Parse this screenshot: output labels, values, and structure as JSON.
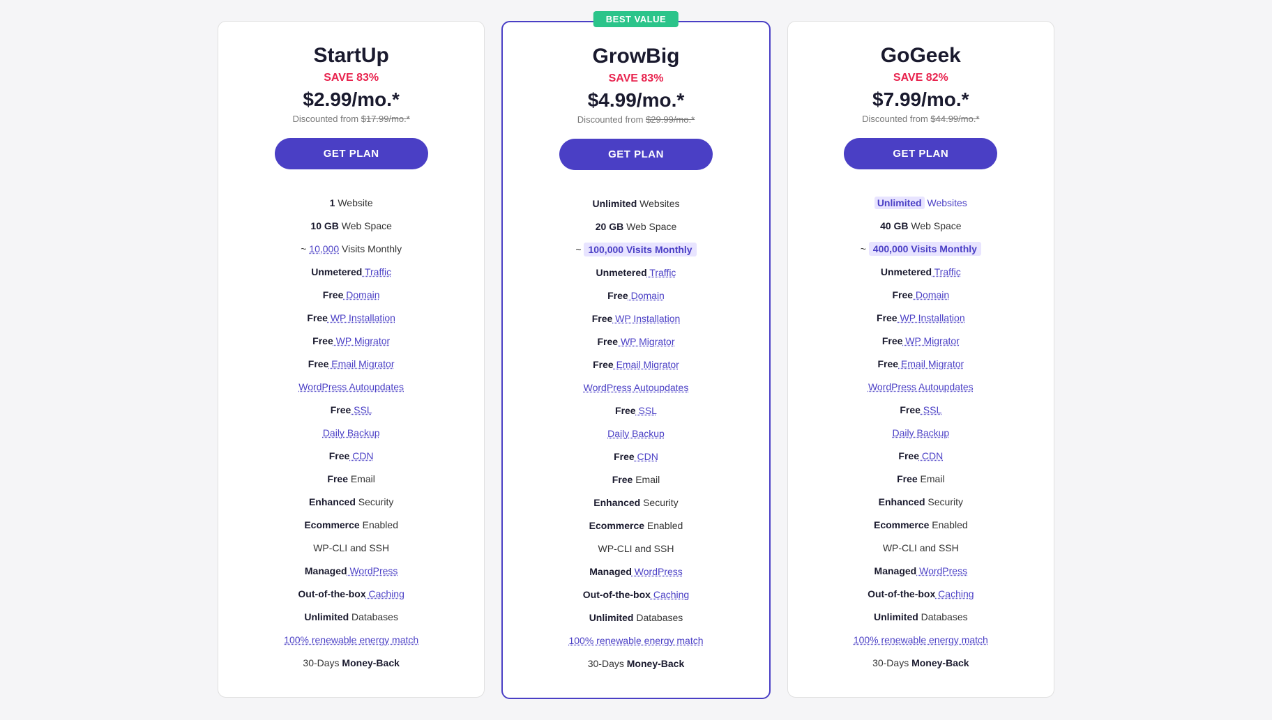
{
  "plans": [
    {
      "id": "startup",
      "name": "StartUp",
      "save": "SAVE 83%",
      "price": "$2.99/mo.*",
      "original": "$17.99/mo.*",
      "originalText": "Discounted from",
      "btn": "GET PLAN",
      "featured": false,
      "features": [
        {
          "text": "1 Website",
          "parts": [
            {
              "t": "1",
              "style": "bold"
            },
            {
              "t": " Website",
              "style": "normal"
            }
          ]
        },
        {
          "text": "10 GB Web Space",
          "parts": [
            {
              "t": "10 GB",
              "style": "bold"
            },
            {
              "t": " Web Space",
              "style": "normal"
            }
          ]
        },
        {
          "text": "~ 10,000 Visits Monthly",
          "parts": [
            {
              "t": "~ "
            },
            {
              "t": "10,000",
              "style": "link"
            },
            {
              "t": " Visits Monthly",
              "style": "normal"
            }
          ]
        },
        {
          "text": "Unmetered Traffic",
          "parts": [
            {
              "t": "Unmetered",
              "style": "bold"
            },
            {
              "t": " Traffic",
              "style": "link"
            }
          ]
        },
        {
          "text": "Free Domain",
          "parts": [
            {
              "t": "Free",
              "style": "bold"
            },
            {
              "t": " Domain",
              "style": "link"
            }
          ]
        },
        {
          "text": "Free WP Installation",
          "parts": [
            {
              "t": "Free",
              "style": "bold"
            },
            {
              "t": " WP Installation",
              "style": "link"
            }
          ]
        },
        {
          "text": "Free WP Migrator",
          "parts": [
            {
              "t": "Free",
              "style": "bold"
            },
            {
              "t": " WP Migrator",
              "style": "link"
            }
          ]
        },
        {
          "text": "Free Email Migrator",
          "parts": [
            {
              "t": "Free",
              "style": "bold"
            },
            {
              "t": " Email Migrator",
              "style": "link"
            }
          ]
        },
        {
          "text": "WordPress Autoupdates",
          "parts": [
            {
              "t": "WordPress Autoupdates",
              "style": "link"
            }
          ]
        },
        {
          "text": "Free SSL",
          "parts": [
            {
              "t": "Free",
              "style": "bold"
            },
            {
              "t": " SSL",
              "style": "link"
            }
          ]
        },
        {
          "text": "Daily Backup",
          "parts": [
            {
              "t": "Daily Backup",
              "style": "link"
            }
          ]
        },
        {
          "text": "Free CDN",
          "parts": [
            {
              "t": "Free",
              "style": "bold"
            },
            {
              "t": " CDN",
              "style": "link"
            }
          ]
        },
        {
          "text": "Free Email",
          "parts": [
            {
              "t": "Free",
              "style": "bold"
            },
            {
              "t": " Email",
              "style": "normal"
            }
          ]
        },
        {
          "text": "Enhanced Security",
          "parts": [
            {
              "t": "Enhanced",
              "style": "bold"
            },
            {
              "t": " Security",
              "style": "normal"
            }
          ]
        },
        {
          "text": "Ecommerce Enabled",
          "parts": [
            {
              "t": "Ecommerce",
              "style": "bold"
            },
            {
              "t": " Enabled",
              "style": "normal"
            }
          ]
        },
        {
          "text": "WP-CLI and SSH",
          "parts": [
            {
              "t": "WP-CLI and SSH",
              "style": "normal"
            }
          ]
        },
        {
          "text": "Managed WordPress",
          "parts": [
            {
              "t": "Managed",
              "style": "bold"
            },
            {
              "t": " WordPress",
              "style": "link"
            }
          ]
        },
        {
          "text": "Out-of-the-box Caching",
          "parts": [
            {
              "t": "Out-of-the-box",
              "style": "bold"
            },
            {
              "t": " Caching",
              "style": "link"
            }
          ]
        },
        {
          "text": "Unlimited Databases",
          "parts": [
            {
              "t": "Unlimited",
              "style": "bold"
            },
            {
              "t": " Databases",
              "style": "normal"
            }
          ]
        },
        {
          "text": "100% renewable energy match",
          "parts": [
            {
              "t": "100% renewable energy match",
              "style": "link"
            }
          ]
        },
        {
          "text": "30-Days Money-Back",
          "parts": [
            {
              "t": "30-Days",
              "style": "normal"
            },
            {
              "t": " Money-Back",
              "style": "bold"
            }
          ]
        }
      ]
    },
    {
      "id": "growbig",
      "name": "GrowBig",
      "save": "SAVE 83%",
      "price": "$4.99/mo.*",
      "original": "$29.99/mo.*",
      "originalText": "Discounted from",
      "btn": "GET PLAN",
      "featured": true,
      "bestValue": "BEST VALUE",
      "features": [
        {
          "text": "Unlimited Websites",
          "parts": [
            {
              "t": "Unlimited",
              "style": "bold"
            },
            {
              "t": " Websites",
              "style": "normal"
            }
          ]
        },
        {
          "text": "20 GB Web Space",
          "parts": [
            {
              "t": "20 GB",
              "style": "bold"
            },
            {
              "t": " Web Space",
              "style": "normal"
            }
          ]
        },
        {
          "text": "~ 100,000 Visits Monthly",
          "parts": [
            {
              "t": "~ "
            },
            {
              "t": "100,000 Visits Monthly",
              "style": "visits-highlight"
            }
          ]
        },
        {
          "text": "Unmetered Traffic",
          "parts": [
            {
              "t": "Unmetered",
              "style": "bold"
            },
            {
              "t": " Traffic",
              "style": "link"
            }
          ]
        },
        {
          "text": "Free Domain",
          "parts": [
            {
              "t": "Free",
              "style": "bold"
            },
            {
              "t": " Domain",
              "style": "link"
            }
          ]
        },
        {
          "text": "Free WP Installation",
          "parts": [
            {
              "t": "Free",
              "style": "bold"
            },
            {
              "t": " WP Installation",
              "style": "link"
            }
          ]
        },
        {
          "text": "Free WP Migrator",
          "parts": [
            {
              "t": "Free",
              "style": "bold"
            },
            {
              "t": " WP Migrator",
              "style": "link"
            }
          ]
        },
        {
          "text": "Free Email Migrator",
          "parts": [
            {
              "t": "Free",
              "style": "bold"
            },
            {
              "t": " Email Migrator",
              "style": "link"
            }
          ]
        },
        {
          "text": "WordPress Autoupdates",
          "parts": [
            {
              "t": "WordPress Autoupdates",
              "style": "link"
            }
          ]
        },
        {
          "text": "Free SSL",
          "parts": [
            {
              "t": "Free",
              "style": "bold"
            },
            {
              "t": " SSL",
              "style": "link"
            }
          ]
        },
        {
          "text": "Daily Backup",
          "parts": [
            {
              "t": "Daily Backup",
              "style": "link"
            }
          ]
        },
        {
          "text": "Free CDN",
          "parts": [
            {
              "t": "Free",
              "style": "bold"
            },
            {
              "t": " CDN",
              "style": "link"
            }
          ]
        },
        {
          "text": "Free Email",
          "parts": [
            {
              "t": "Free",
              "style": "bold"
            },
            {
              "t": " Email",
              "style": "normal"
            }
          ]
        },
        {
          "text": "Enhanced Security",
          "parts": [
            {
              "t": "Enhanced",
              "style": "bold"
            },
            {
              "t": " Security",
              "style": "normal"
            }
          ]
        },
        {
          "text": "Ecommerce Enabled",
          "parts": [
            {
              "t": "Ecommerce",
              "style": "bold"
            },
            {
              "t": " Enabled",
              "style": "normal"
            }
          ]
        },
        {
          "text": "WP-CLI and SSH",
          "parts": [
            {
              "t": "WP-CLI and SSH",
              "style": "normal"
            }
          ]
        },
        {
          "text": "Managed WordPress",
          "parts": [
            {
              "t": "Managed",
              "style": "bold"
            },
            {
              "t": " WordPress",
              "style": "link"
            }
          ]
        },
        {
          "text": "Out-of-the-box Caching",
          "parts": [
            {
              "t": "Out-of-the-box",
              "style": "bold"
            },
            {
              "t": " Caching",
              "style": "link"
            }
          ]
        },
        {
          "text": "Unlimited Databases",
          "parts": [
            {
              "t": "Unlimited",
              "style": "bold"
            },
            {
              "t": " Databases",
              "style": "normal"
            }
          ]
        },
        {
          "text": "100% renewable energy match",
          "parts": [
            {
              "t": "100% renewable energy match",
              "style": "link"
            }
          ]
        },
        {
          "text": "30-Days Money-Back",
          "parts": [
            {
              "t": "30-Days",
              "style": "normal"
            },
            {
              "t": " Money-Back",
              "style": "bold"
            }
          ]
        }
      ]
    },
    {
      "id": "gogeek",
      "name": "GoGeek",
      "save": "SAVE 82%",
      "price": "$7.99/mo.*",
      "original": "$44.99/mo.*",
      "originalText": "Discounted from",
      "btn": "GET PLAN",
      "featured": false,
      "features": [
        {
          "text": "Unlimited Websites",
          "parts": [
            {
              "t": "Unlimited",
              "style": "purple-highlight"
            },
            {
              "t": " Websites",
              "style": "purple-text"
            }
          ]
        },
        {
          "text": "40 GB Web Space",
          "parts": [
            {
              "t": "40 GB",
              "style": "bold"
            },
            {
              "t": " Web Space",
              "style": "normal"
            }
          ]
        },
        {
          "text": "~ 400,000 Visits Monthly",
          "parts": [
            {
              "t": "~ "
            },
            {
              "t": "400,000 Visits Monthly",
              "style": "visits-highlight"
            }
          ]
        },
        {
          "text": "Unmetered Traffic",
          "parts": [
            {
              "t": "Unmetered",
              "style": "bold"
            },
            {
              "t": " Traffic",
              "style": "link"
            }
          ]
        },
        {
          "text": "Free Domain",
          "parts": [
            {
              "t": "Free",
              "style": "bold"
            },
            {
              "t": " Domain",
              "style": "link"
            }
          ]
        },
        {
          "text": "Free WP Installation",
          "parts": [
            {
              "t": "Free",
              "style": "bold"
            },
            {
              "t": " WP Installation",
              "style": "link"
            }
          ]
        },
        {
          "text": "Free WP Migrator",
          "parts": [
            {
              "t": "Free",
              "style": "bold"
            },
            {
              "t": " WP Migrator",
              "style": "link"
            }
          ]
        },
        {
          "text": "Free Email Migrator",
          "parts": [
            {
              "t": "Free",
              "style": "bold"
            },
            {
              "t": " Email Migrator",
              "style": "link"
            }
          ]
        },
        {
          "text": "WordPress Autoupdates",
          "parts": [
            {
              "t": "WordPress Autoupdates",
              "style": "link"
            }
          ]
        },
        {
          "text": "Free SSL",
          "parts": [
            {
              "t": "Free",
              "style": "bold"
            },
            {
              "t": " SSL",
              "style": "link"
            }
          ]
        },
        {
          "text": "Daily Backup",
          "parts": [
            {
              "t": "Daily Backup",
              "style": "link"
            }
          ]
        },
        {
          "text": "Free CDN",
          "parts": [
            {
              "t": "Free",
              "style": "bold"
            },
            {
              "t": " CDN",
              "style": "link"
            }
          ]
        },
        {
          "text": "Free Email",
          "parts": [
            {
              "t": "Free",
              "style": "bold"
            },
            {
              "t": " Email",
              "style": "normal"
            }
          ]
        },
        {
          "text": "Enhanced Security",
          "parts": [
            {
              "t": "Enhanced",
              "style": "bold"
            },
            {
              "t": " Security",
              "style": "normal"
            }
          ]
        },
        {
          "text": "Ecommerce Enabled",
          "parts": [
            {
              "t": "Ecommerce",
              "style": "bold"
            },
            {
              "t": " Enabled",
              "style": "normal"
            }
          ]
        },
        {
          "text": "WP-CLI and SSH",
          "parts": [
            {
              "t": "WP-CLI and SSH",
              "style": "normal"
            }
          ]
        },
        {
          "text": "Managed WordPress",
          "parts": [
            {
              "t": "Managed",
              "style": "bold"
            },
            {
              "t": " WordPress",
              "style": "link"
            }
          ]
        },
        {
          "text": "Out-of-the-box Caching",
          "parts": [
            {
              "t": "Out-of-the-box",
              "style": "bold"
            },
            {
              "t": " Caching",
              "style": "link"
            }
          ]
        },
        {
          "text": "Unlimited Databases",
          "parts": [
            {
              "t": "Unlimited",
              "style": "bold"
            },
            {
              "t": " Databases",
              "style": "normal"
            }
          ]
        },
        {
          "text": "100% renewable energy match",
          "parts": [
            {
              "t": "100% renewable energy match",
              "style": "link"
            }
          ]
        },
        {
          "text": "30-Days Money-Back",
          "parts": [
            {
              "t": "30-Days",
              "style": "normal"
            },
            {
              "t": " Money-Back",
              "style": "bold"
            }
          ]
        }
      ]
    }
  ]
}
